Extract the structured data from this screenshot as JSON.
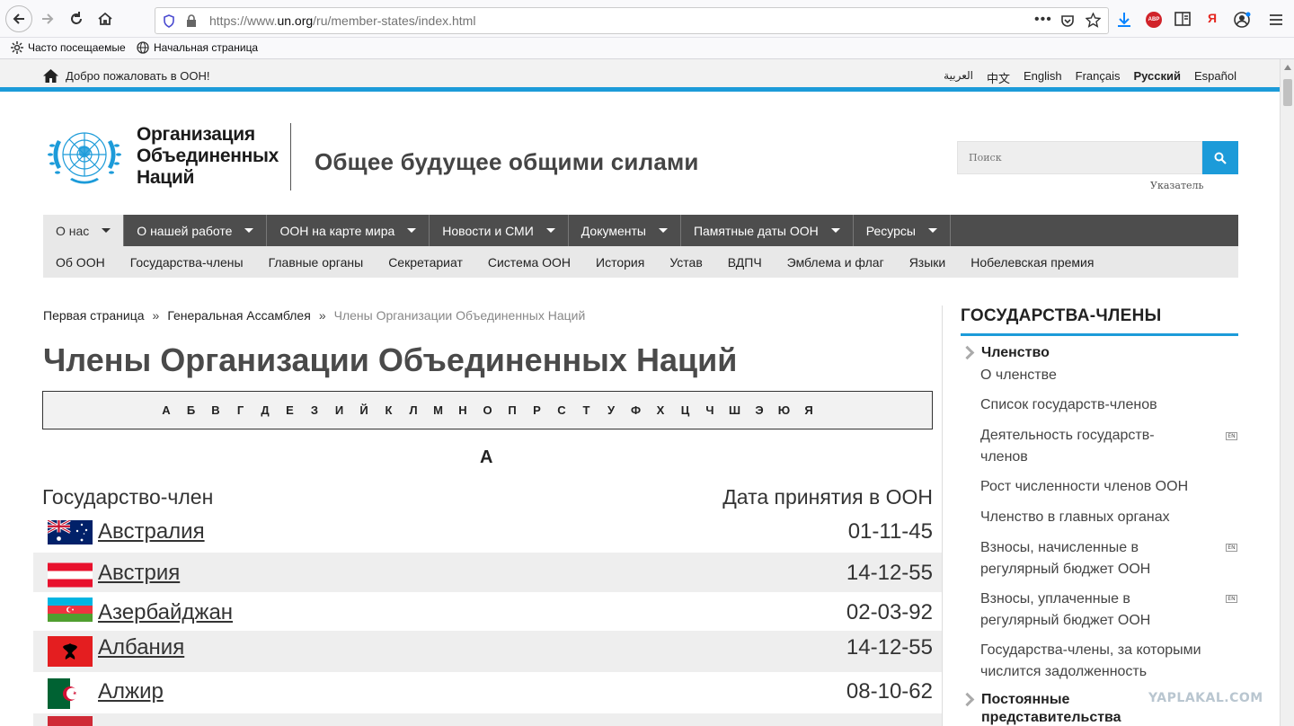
{
  "browser": {
    "url_prefix": "https://www.",
    "url_domain": "un.org",
    "url_path": "/ru/member-states/index.html",
    "bookmarks": [
      "Часто посещаемые",
      "Начальная страница"
    ],
    "ext_abp": "ABP",
    "ext_ya": "Я"
  },
  "topbar": {
    "welcome": "Добро пожаловать в ООН!",
    "languages": [
      "العربية",
      "中文",
      "English",
      "Français",
      "Русский",
      "Español"
    ],
    "active_language": "Русский"
  },
  "header": {
    "org_line1": "Организация",
    "org_line2": "Объединенных",
    "org_line3": "Наций",
    "slogan": "Общее будущее общими силами",
    "search_placeholder": "Поиск",
    "index_link": "Указатель"
  },
  "mainnav": [
    "О нас",
    "О нашей работе",
    "ООН на карте мира",
    "Новости и СМИ",
    "Документы",
    "Памятные даты ООН",
    "Ресурсы"
  ],
  "subnav": [
    "Об ООН",
    "Государства-члены",
    "Главные органы",
    "Секретариат",
    "Система ООН",
    "История",
    "Устав",
    "ВДПЧ",
    "Эмблема и флаг",
    "Языки",
    "Нобелевская премия"
  ],
  "breadcrumb": [
    "Первая страница",
    "Генеральная Ассамблея",
    "Члены Организации Объединенных Наций"
  ],
  "breadcrumb_sep": "»",
  "page_title": "Члены Организации Объединенных Наций",
  "alphabet": [
    "А",
    "Б",
    "В",
    "Г",
    "Д",
    "Е",
    "З",
    "И",
    "Й",
    "К",
    "Л",
    "М",
    "Н",
    "О",
    "П",
    "Р",
    "С",
    "Т",
    "У",
    "Ф",
    "Х",
    "Ц",
    "Ч",
    "Ш",
    "Э",
    "Ю",
    "Я"
  ],
  "section_letter": "А",
  "table": {
    "col_state": "Государство-член",
    "col_date": "Дата принятия в ООН",
    "rows": [
      {
        "name": "Австралия",
        "date": "01-11-45",
        "flag": "australia"
      },
      {
        "name": "Австрия",
        "date": "14-12-55",
        "flag": "austria"
      },
      {
        "name": "Азербайджан",
        "date": "02-03-92",
        "flag": "azerbaijan"
      },
      {
        "name": "Албания",
        "date": "14-12-55",
        "flag": "albania"
      },
      {
        "name": "Алжир",
        "date": "08-10-62",
        "flag": "algeria"
      }
    ]
  },
  "sidebar": {
    "title": "ГОСУДАРСТВА-ЧЛЕНЫ",
    "section1": "Членство",
    "links": [
      "О членстве",
      "Список государств-членов",
      "Деятельность государств-членов",
      "Рост численности членов ООН",
      "Членство в главных органах",
      "Взносы, начисленные в регулярный бюджет ООН",
      "Взносы, уплаченные в регулярный бюджет ООН",
      "Государства-члены, за которыми числится задолженность"
    ],
    "ext_badge": "EN",
    "section2_line1": "Постоянные",
    "section2_line2": "представительства"
  },
  "watermark": "YAPLAKAL.COM",
  "colors": {
    "accent": "#1c9bd9",
    "nav": "#4d4d4d",
    "subnav": "#e8e8e8"
  }
}
